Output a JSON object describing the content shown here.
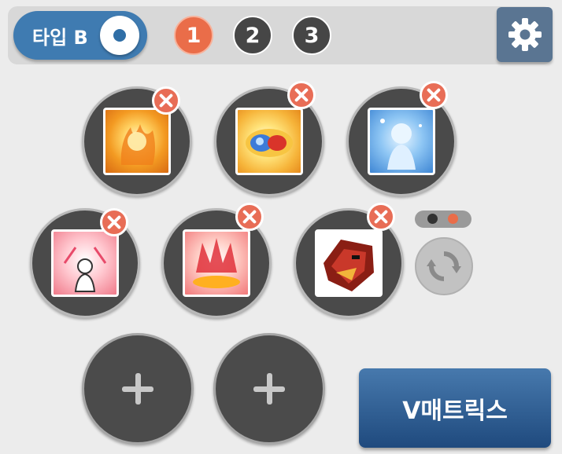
{
  "header": {
    "type_toggle_label": "타입 B",
    "pages": [
      "1",
      "2",
      "3"
    ],
    "active_page": "1"
  },
  "skills": [
    {
      "icon": "orange-flame-spirit-skill-icon",
      "removable": true
    },
    {
      "icon": "blue-red-orb-skill-icon",
      "removable": true
    },
    {
      "icon": "blue-ice-figure-skill-icon",
      "removable": true
    },
    {
      "icon": "pink-aura-figure-skill-icon",
      "removable": true
    },
    {
      "icon": "red-crown-flame-skill-icon",
      "removable": true
    },
    {
      "icon": "dragon-mask-skill-icon",
      "removable": true
    }
  ],
  "empty_slots": 2,
  "slot_page_indicator": {
    "count": 2,
    "active_index": 1
  },
  "buttons": {
    "vmatrix": "V매트릭스"
  },
  "colors": {
    "accent_orange": "#ea6d49",
    "toggle_blue": "#3f7bb1",
    "settings_blue": "#5a7592",
    "vmatrix_blue": "#2d5b91",
    "slot_dark": "#4a4a4a"
  }
}
